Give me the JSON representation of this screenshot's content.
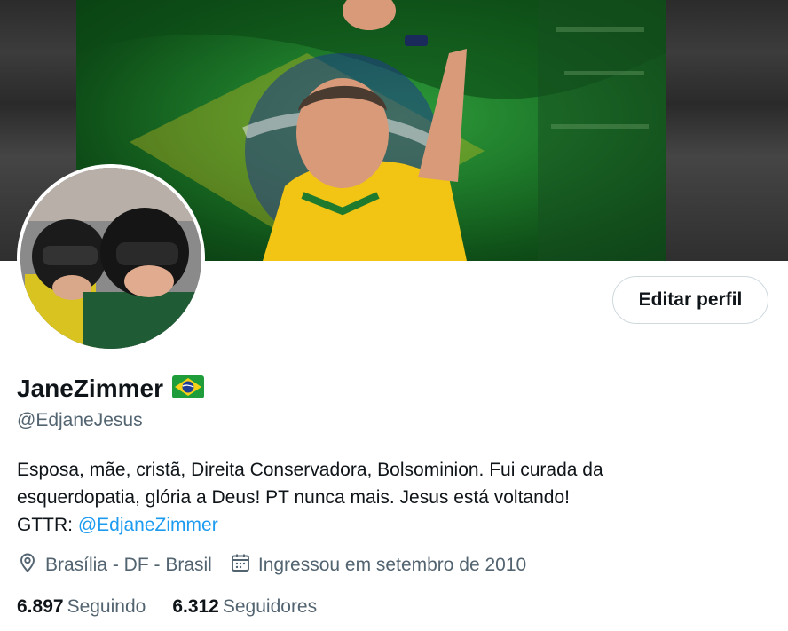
{
  "profile": {
    "name": "JaneZimmer",
    "flag_emoji": "brazil-flag",
    "handle": "@EdjaneJesus",
    "bio": {
      "line1": "Esposa, mãe, cristã, Direita Conservadora, Bolsominion. Fui curada da",
      "line2": "esquerdopatia, glória a Deus! PT nunca mais. Jesus está voltando!",
      "line3_prefix": "GTTR: ",
      "line3_link": "@EdjaneZimmer"
    },
    "location": "Brasília - DF - Brasil",
    "joined": "Ingressou em setembro de 2010",
    "following": {
      "count": "6.897",
      "label": "Seguindo"
    },
    "followers": {
      "count": "6.312",
      "label": "Seguidores"
    }
  },
  "actions": {
    "edit_profile": "Editar perfil"
  },
  "icons": {
    "location": "location-pin-icon",
    "calendar": "calendar-icon"
  },
  "colors": {
    "link": "#1d9bf0",
    "secondary_text": "#536471",
    "primary_text": "#0f1419",
    "border": "#cfd9de"
  }
}
